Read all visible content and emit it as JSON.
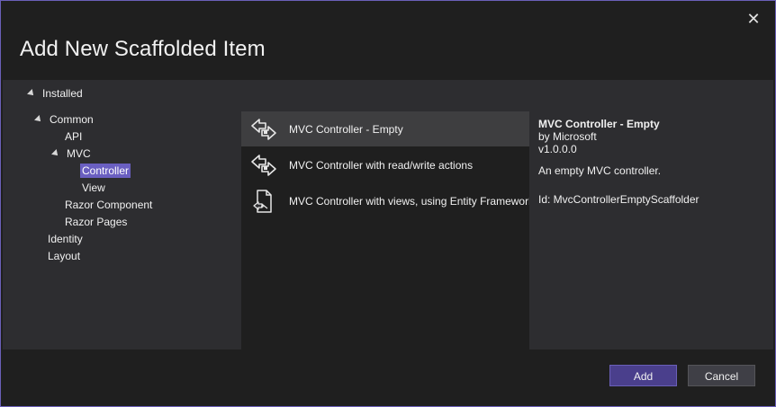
{
  "dialog": {
    "title": "Add New Scaffolded Item",
    "close_glyph": "✕"
  },
  "tree": {
    "root": "Installed",
    "nodes": [
      {
        "label": "Common"
      },
      {
        "label": "API"
      },
      {
        "label": "MVC"
      },
      {
        "label": "Controller",
        "selected": true
      },
      {
        "label": "View"
      },
      {
        "label": "Razor Component"
      },
      {
        "label": "Razor Pages"
      },
      {
        "label": "Identity"
      },
      {
        "label": "Layout"
      }
    ]
  },
  "templates": [
    {
      "label": "MVC Controller - Empty",
      "icon": "controller-icon",
      "selected": true
    },
    {
      "label": "MVC Controller with read/write actions",
      "icon": "controller-icon"
    },
    {
      "label": "MVC Controller with views, using Entity Framework",
      "icon": "entity-framework-document-icon"
    }
  ],
  "details": {
    "title": "MVC Controller - Empty",
    "author": "by Microsoft",
    "version": "v1.0.0.0",
    "description": "An empty MVC controller.",
    "id": "Id: MvcControllerEmptyScaffolder"
  },
  "buttons": {
    "add": "Add",
    "cancel": "Cancel"
  },
  "colors": {
    "accent": "#6a5fc1",
    "dialog_border": "#6a5fb8",
    "add_button": "#4a3f8c"
  }
}
